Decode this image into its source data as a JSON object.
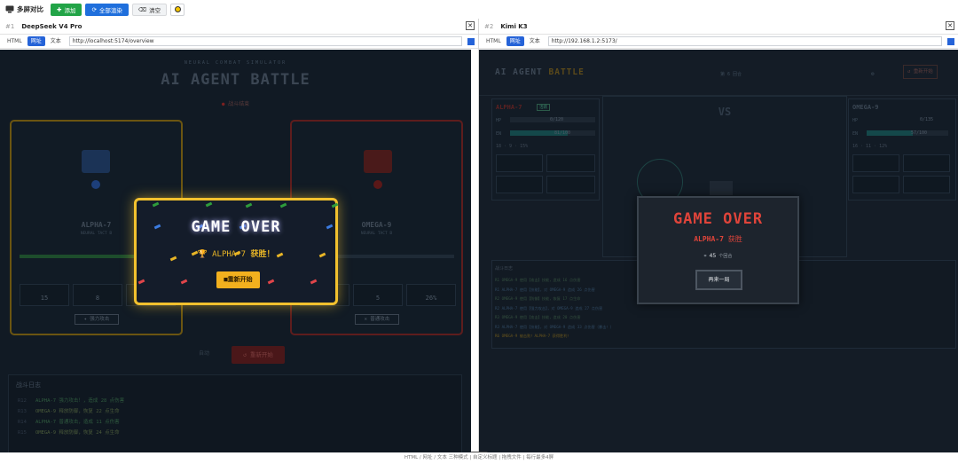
{
  "toolbar": {
    "title": "多屏对比",
    "add_label": "添加",
    "refresh_all_label": "全部渲染",
    "clear_label": "清空",
    "monitor_icon": "monitor-icon",
    "theme_icon": "sun-icon"
  },
  "panes": [
    {
      "num": "#1",
      "model": "DeepSeek V4 Pro",
      "modes": [
        "HTML",
        "网址",
        "文本"
      ],
      "active_mode": "网址",
      "url": "http://localhost:5174/overview",
      "app": {
        "subtitle": "NEURAL COMBAT SIMULATOR",
        "title": "AI AGENT BATTLE",
        "status": "战斗结束",
        "left_name": "ALPHA-7",
        "left_class": "NEURAL TACT B",
        "right_name": "OMEGA-9",
        "right_class": "NEURAL TACT B",
        "left_stats": [
          "15",
          "8",
          "",
          ""
        ],
        "right_stats": [
          "",
          "5",
          "26%"
        ],
        "left_skill": "强力攻击",
        "right_skill": "普通攻击",
        "auto_label": "自动",
        "restart_label": "重新开始",
        "log_title": "战斗日志",
        "log_lines": [
          {
            "turn": "R12",
            "text": "ALPHA-7 强力攻击！，造成 28 点伤害"
          },
          {
            "turn": "R13",
            "text": "OMEGA-9 释放防御，恢复 22 点生命"
          },
          {
            "turn": "R14",
            "text": "ALPHA-7 普通攻击，造成 11 点伤害"
          },
          {
            "turn": "R15",
            "text": "OMEGA-9 释放防御，恢复 24 点生命"
          }
        ],
        "modal": {
          "title": "GAME OVER",
          "winner": "ALPHA-7",
          "win_word": "获胜！",
          "button": "重新开始",
          "trophy_icon": "trophy-icon",
          "accent": "#f2c12e"
        }
      }
    },
    {
      "num": "#2",
      "model": "Kimi K3",
      "modes": [
        "HTML",
        "网址",
        "文本"
      ],
      "active_mode": "网址",
      "url": "http://192.168.1.2:5173/",
      "app": {
        "title_a": "AI AGENT",
        "title_b": "BATTLE",
        "round": "第 6 回合",
        "start_label": "重新开始",
        "vs": "VS",
        "left_name": "ALPHA-7",
        "left_tag": "活跃",
        "left_hp_label": "HP",
        "left_hp": "0/120",
        "left_en_label": "EN",
        "left_en": "81/100",
        "left_stats_line": "18 · 9 · 15%",
        "right_name": "OMEGA-9",
        "right_hp_label": "HP",
        "right_hp": "0/135",
        "right_en_label": "EN",
        "right_en": "57/100",
        "right_stats_line": "16 · 11 · 12%",
        "log_title": "战斗日志",
        "log_lines": [
          "R1 OMEGA-9 使用【攻击】技能，造成 16 点伤害",
          "R1 ALPHA-7 使用【技能】，对 OMEGA-9 造成 26 点伤害",
          "R2 OMEGA-9 使用【防御】技能，恢复 17 点生命",
          "R2 ALPHA-7 使用【强力攻击】，对 OMEGA-9 造成 27 点伤害",
          "R3 OMEGA-9 使用【攻击】技能，造成 20 点伤害",
          "R3 ALPHA-7 使用【技能】，对 OMEGA-9 造成 33 点伤害（暴击！）",
          "R6 OMEGA-9 被击败！ALPHA-7 获得胜利！"
        ],
        "modal": {
          "title": "GAME OVER",
          "winner": "ALPHA-7",
          "win_word": "获胜",
          "rounds_num": "45",
          "rounds_label": "个回合",
          "button": "再来一局",
          "accent": "#e0443a"
        }
      }
    }
  ],
  "footer": "HTML / 网址 / 文本 三种模式 | 自定义标题 | 拖拽文件 | 每行最多4屏"
}
